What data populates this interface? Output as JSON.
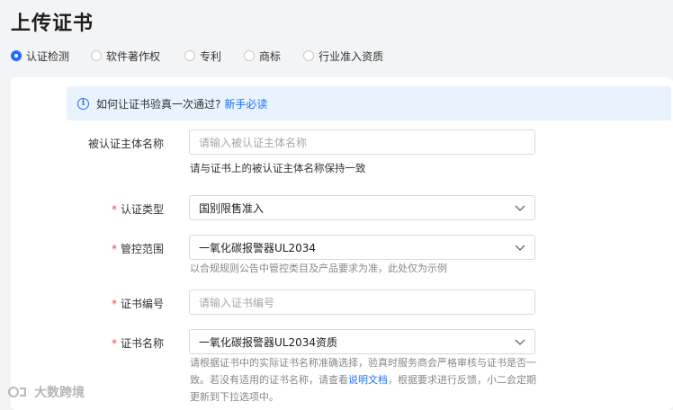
{
  "page_title": "上传证书",
  "tabs": [
    {
      "label": "认证检测",
      "checked": true
    },
    {
      "label": "软件著作权",
      "checked": false
    },
    {
      "label": "专利",
      "checked": false
    },
    {
      "label": "商标",
      "checked": false
    },
    {
      "label": "行业准入资质",
      "checked": false
    }
  ],
  "notice": {
    "text": "如何让证书验真一次通过?",
    "link": "新手必读"
  },
  "form": {
    "subject_name": {
      "label": "被认证主体名称",
      "placeholder": "请输入被认证主体名称",
      "hint": "请与证书上的被认证主体名称保持一致"
    },
    "cert_type": {
      "label": "认证类型",
      "value": "国别限售准入"
    },
    "scope": {
      "label": "管控范围",
      "value": "一氧化碳报警器UL2034",
      "hint": "以合规规则公告中管控类目及产品要求为准，此处仅为示例"
    },
    "cert_no": {
      "label": "证书编号",
      "placeholder": "请输入证书编号"
    },
    "cert_name": {
      "label": "证书名称",
      "value": "一氧化碳报警器UL2034资质",
      "hint_line1": "请根据证书中的实际证书名称准确选择，验真时服务商会严格审核与证书是否一",
      "hint_line2_pre": "致。若没有适用的证书名称，请查看",
      "hint_link": "说明文档",
      "hint_line2_post": "，根据要求进行反馈，小二会定期",
      "hint_line3": "更新到下拉选项中。"
    }
  },
  "watermark": "大数跨境",
  "colors": {
    "accent": "#1e6fff",
    "required": "#e5484d",
    "notice_bg": "#e8f3fe"
  }
}
